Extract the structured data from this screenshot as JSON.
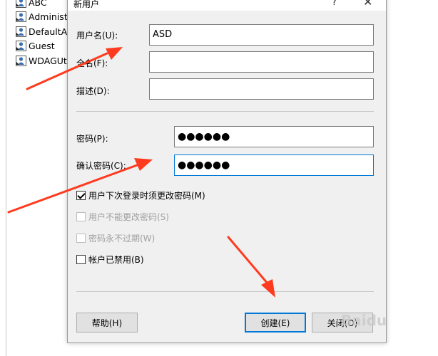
{
  "user_list": [
    {
      "name": "ABC"
    },
    {
      "name": "Administr"
    },
    {
      "name": "DefaultAc"
    },
    {
      "name": "Guest"
    },
    {
      "name": "WDAGUti"
    }
  ],
  "dialog": {
    "title": "新用户",
    "help_glyph": "?",
    "close_glyph": "✕",
    "username_label": "用户名(U):",
    "username_value": "ASD",
    "fullname_label": "全名(F):",
    "fullname_value": "",
    "description_label": "描述(D):",
    "description_value": "",
    "password_label": "密码(P):",
    "password_value": "●●●●●●",
    "confirm_label": "确认密码(C):",
    "confirm_value": "●●●●●●",
    "checkboxes": [
      {
        "label": "用户下次登录时须更改密码(M)",
        "checked": true,
        "enabled": true
      },
      {
        "label": "用户不能更改密码(S)",
        "checked": false,
        "enabled": false
      },
      {
        "label": "密码永不过期(W)",
        "checked": false,
        "enabled": false
      },
      {
        "label": "帐户已禁用(B)",
        "checked": false,
        "enabled": true
      }
    ],
    "help_button": "帮助(H)",
    "create_button": "创建(E)",
    "close_button": "关闭(O)"
  },
  "watermark": "Baidu",
  "colors": {
    "arrow": "#ff3b1f",
    "focus_border": "#0078d7",
    "dialog_bg": "#f0f0f0"
  },
  "icons": [
    "user-icon",
    "help-icon",
    "close-icon",
    "checkbox-checked-icon",
    "arrow-annotation"
  ]
}
